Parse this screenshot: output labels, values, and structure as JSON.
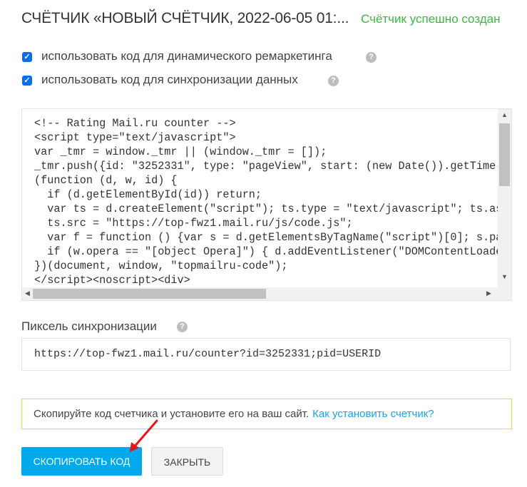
{
  "header": {
    "title": "СЧЁТЧИК «НОВЫЙ СЧЁТЧИК, 2022-06-05 01:...",
    "status": "Счётчик успешно создан"
  },
  "options": [
    {
      "label": "использовать код для динамического ремаркетинга",
      "checked": true,
      "help_icon": "question-circle-icon"
    },
    {
      "label": "использовать код для синхронизации данных",
      "checked": true,
      "help_icon": "question-circle-icon"
    }
  ],
  "code": {
    "text": "<!-- Rating Mail.ru counter -->\n<script type=\"text/javascript\">\nvar _tmr = window._tmr || (window._tmr = []);\n_tmr.push({id: \"3252331\", type: \"pageView\", start: (new Date()).getTime()});\n(function (d, w, id) {\n  if (d.getElementById(id)) return;\n  var ts = d.createElement(\"script\"); ts.type = \"text/javascript\"; ts.async = true; ts.id = id;\n  ts.src = \"https://top-fwz1.mail.ru/js/code.js\";\n  var f = function () {var s = d.getElementsByTagName(\"script\")[0]; s.parentNode.insertBefore(ts, s);};\n  if (w.opera == \"[object Opera]\") { d.addEventListener(\"DOMContentLoaded\", f, false); } else { f(); }\n})(document, window, \"topmailru-code\");\n</script><noscript><div>"
  },
  "pixel": {
    "label": "Пиксель синхронизации",
    "value": "https://top-fwz1.mail.ru/counter?id=3252331;pid=USERID"
  },
  "notice": {
    "text": "Скопируйте код счетчика и установите его на ваш сайт.",
    "link": "Как установить счетчик?",
    "border_color": "#f5d33a"
  },
  "buttons": {
    "copy": "СКОПИРОВАТЬ КОД",
    "close": "ЗАКРЫТЬ"
  },
  "colors": {
    "accent": "#00a9ec",
    "success": "#3cb83c",
    "link": "#1aa3e8",
    "annotation_arrow": "#e8161b"
  }
}
